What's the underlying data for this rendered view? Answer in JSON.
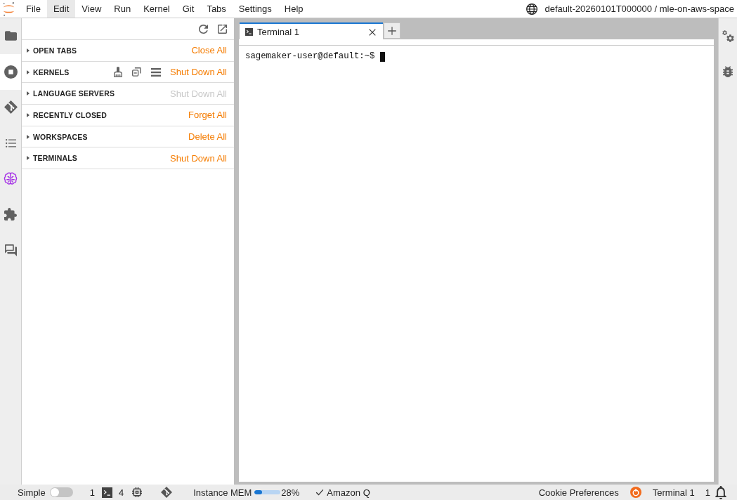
{
  "menu_bar": {
    "items": [
      {
        "label": "File",
        "selected": false
      },
      {
        "label": "Edit",
        "selected": true
      },
      {
        "label": "View",
        "selected": false
      },
      {
        "label": "Run",
        "selected": false
      },
      {
        "label": "Kernel",
        "selected": false
      },
      {
        "label": "Git",
        "selected": false
      },
      {
        "label": "Tabs",
        "selected": false
      },
      {
        "label": "Settings",
        "selected": false
      },
      {
        "label": "Help",
        "selected": false
      }
    ],
    "space": "default-20260101T000000 / mle-on-aws-space"
  },
  "left_sidebar_tabs": [
    {
      "kind": "files",
      "selected": false
    },
    {
      "kind": "running",
      "selected": true
    },
    {
      "kind": "git",
      "selected": false
    },
    {
      "kind": "toc",
      "selected": false
    },
    {
      "kind": "ai",
      "selected": false
    },
    {
      "kind": "extensions",
      "selected": false
    },
    {
      "kind": "chat",
      "selected": false
    }
  ],
  "running_panel": {
    "sections": [
      {
        "kind": "plain",
        "title": "OPEN TABS",
        "expanded": false,
        "action": "Close All",
        "disabled": false
      },
      {
        "kind": "tools",
        "title": "KERNELS",
        "expanded": false,
        "action": "Shut Down All",
        "disabled": false
      },
      {
        "kind": "plain",
        "title": "LANGUAGE SERVERS",
        "expanded": false,
        "action": "Shut Down All",
        "disabled": true
      },
      {
        "kind": "plain",
        "title": "RECENTLY CLOSED",
        "expanded": false,
        "action": "Forget All",
        "disabled": false
      },
      {
        "kind": "plain",
        "title": "WORKSPACES",
        "expanded": false,
        "action": "Delete All",
        "disabled": false
      },
      {
        "kind": "plain",
        "title": "TERMINALS",
        "expanded": false,
        "action": "Shut Down All",
        "disabled": false
      }
    ]
  },
  "main": {
    "tabs": [
      {
        "label": "Terminal 1",
        "selected": true
      }
    ],
    "terminal": {
      "prompt": "sagemaker-user@default:~$",
      "cursor": true
    }
  },
  "right_sidebar_tabs": [
    {
      "kind": "properties",
      "selected": false
    },
    {
      "kind": "debugger",
      "selected": false
    }
  ],
  "status_bar": {
    "simple_mode": {
      "label": "Simple",
      "on": false
    },
    "terminals": "1",
    "kernels": "4",
    "memory": {
      "label": "Instance MEM",
      "level": 0.28,
      "reading": "28%"
    },
    "amazon_q": {
      "label": "Amazon Q",
      "connected": true
    },
    "cookie_preferences": "Cookie Preferences",
    "current_item": "Terminal 1",
    "notifications": "1"
  }
}
